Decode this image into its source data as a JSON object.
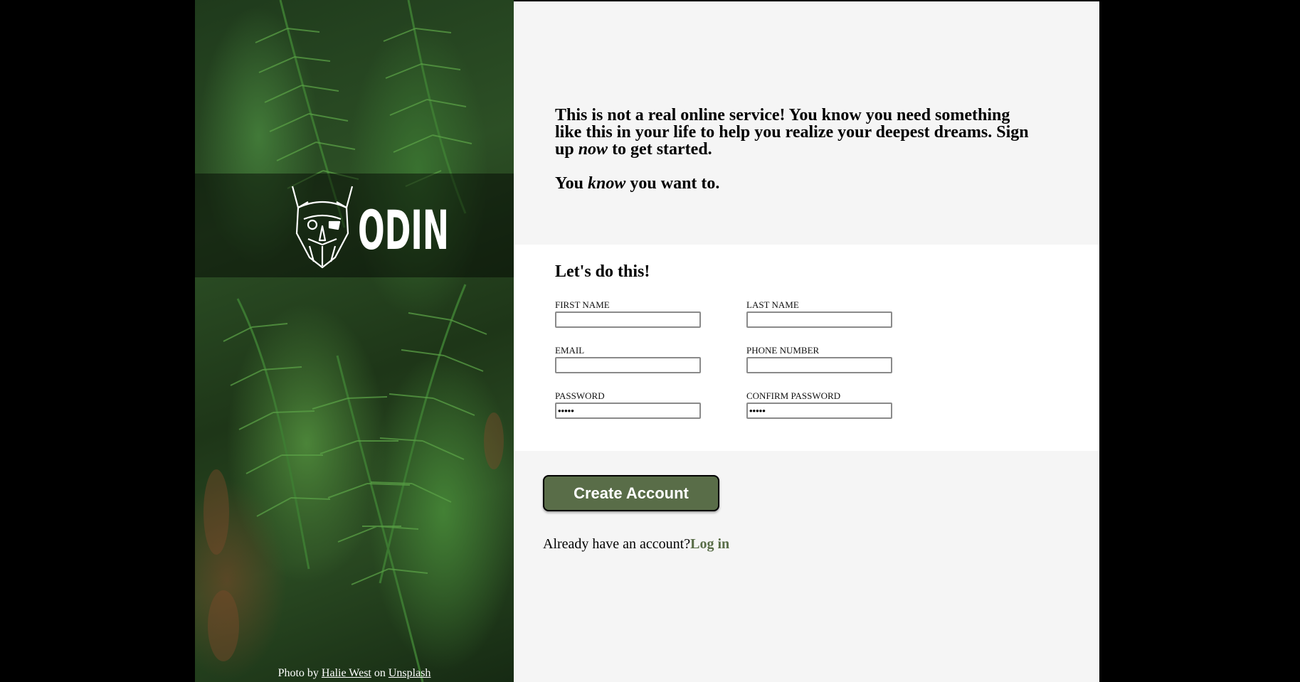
{
  "intro": {
    "line1": "This is not a real online service! You know you need something like this in your life to help you realize your deepest dreams. Sign up ",
    "now": "now",
    "line1_end": " to get started.",
    "line2_start": "You ",
    "know": "know",
    "line2_end": " you want to."
  },
  "logo": {
    "text": "ODIN"
  },
  "credit": {
    "prefix": "Photo by ",
    "author": "Halie West",
    "middle": " on ",
    "site": "Unsplash"
  },
  "form": {
    "heading": "Let's do this!",
    "fields": {
      "first_name": {
        "label": "First Name",
        "value": ""
      },
      "last_name": {
        "label": "Last Name",
        "value": ""
      },
      "email": {
        "label": "Email",
        "value": ""
      },
      "phone": {
        "label": "Phone Number",
        "value": ""
      },
      "password": {
        "label": "Password",
        "value": "•••••"
      },
      "confirm_password": {
        "label": "Confirm Password",
        "value": "•••••"
      }
    },
    "submit_label": "Create Account"
  },
  "login": {
    "prompt": "Already have an account?",
    "link": "Log in"
  },
  "colors": {
    "accent": "#596d48",
    "panel_bg": "#f5f5f5",
    "form_bg": "#ffffff",
    "outer_bg": "#000000"
  }
}
